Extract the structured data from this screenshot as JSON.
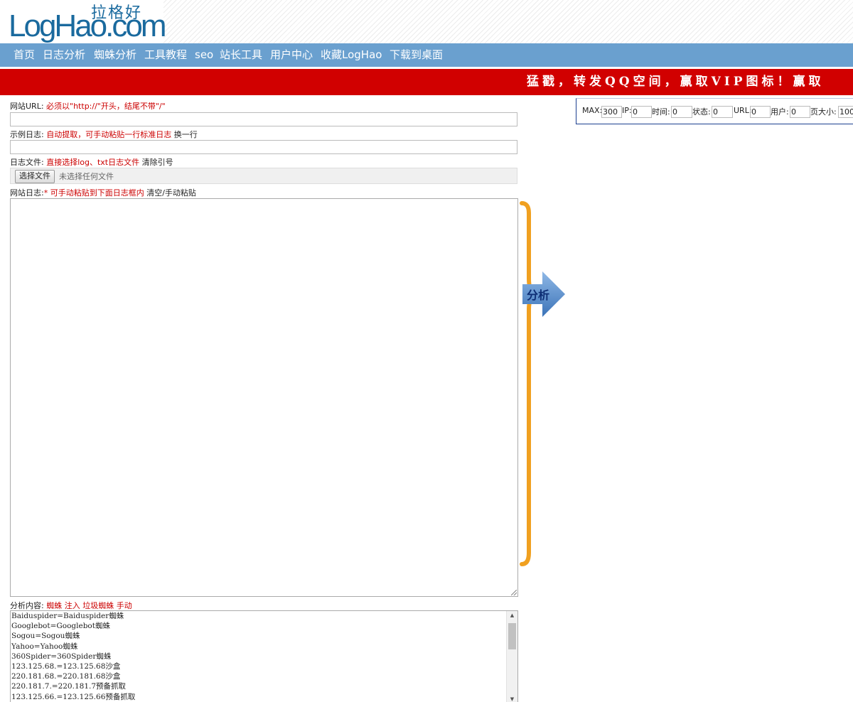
{
  "logo": {
    "text": "LogHao.com",
    "cn": "拉格好"
  },
  "nav": [
    "首页",
    "日志分析",
    "蜘蛛分析",
    "工具教程",
    "seo",
    "站长工具",
    "用户中心",
    "收藏LogHao",
    "下载到桌面"
  ],
  "banner": {
    "text": "猛戳，转发QQ空间，赢取VIP图标！赢取"
  },
  "site_url": {
    "label": "网站URL:",
    "hint": "必须以\"http://\"开头，结尾不带\"/\"",
    "value": ""
  },
  "sample_log": {
    "label": "示例日志:",
    "hint": "自动提取，可手动粘贴一行标准日志",
    "action": "换一行",
    "value": ""
  },
  "log_file": {
    "label": "日志文件:",
    "hint": "直接选择log、txt日志文件",
    "action": "清除引号",
    "button": "选择文件",
    "status": "未选择任何文件"
  },
  "site_log": {
    "label": "网站日志:",
    "required": "*",
    "hint": "可手动粘贴到下面日志框内",
    "action": "清空/手动粘贴",
    "value": ""
  },
  "analyze": {
    "label": "分析"
  },
  "stats": [
    {
      "label": "MAX:",
      "value": "300"
    },
    {
      "label": "IP:",
      "value": "0"
    },
    {
      "label": "时间:",
      "value": "0"
    },
    {
      "label": "状态:",
      "value": "0"
    },
    {
      "label": "URL:",
      "value": "0"
    },
    {
      "label": "用户:",
      "value": "0"
    },
    {
      "label": "页大小:",
      "value": "100"
    }
  ],
  "content": {
    "label": "分析内容:",
    "tabs": [
      "蜘蛛",
      "注入",
      "垃圾蜘蛛",
      "手动"
    ],
    "lines": [
      "Baiduspider=Baiduspider蜘蛛",
      "Googlebot=Googlebot蜘蛛",
      "Sogou=Sogou蜘蛛",
      "Yahoo=Yahoo蜘蛛",
      "360Spider=360Spider蜘蛛",
      "123.125.68.=123.125.68沙盒",
      "220.181.68.=220.181.68沙盒",
      "220.181.7.=220.181.7预备抓取",
      "123.125.66.=123.125.66预备抓取"
    ]
  },
  "colors": {
    "nav": "#6aa0cf",
    "banner": "#d10000",
    "brace": "#f0a020",
    "arrow": "#4f86c6",
    "logo": "#1a6a9e",
    "hint": "#cc0000"
  }
}
